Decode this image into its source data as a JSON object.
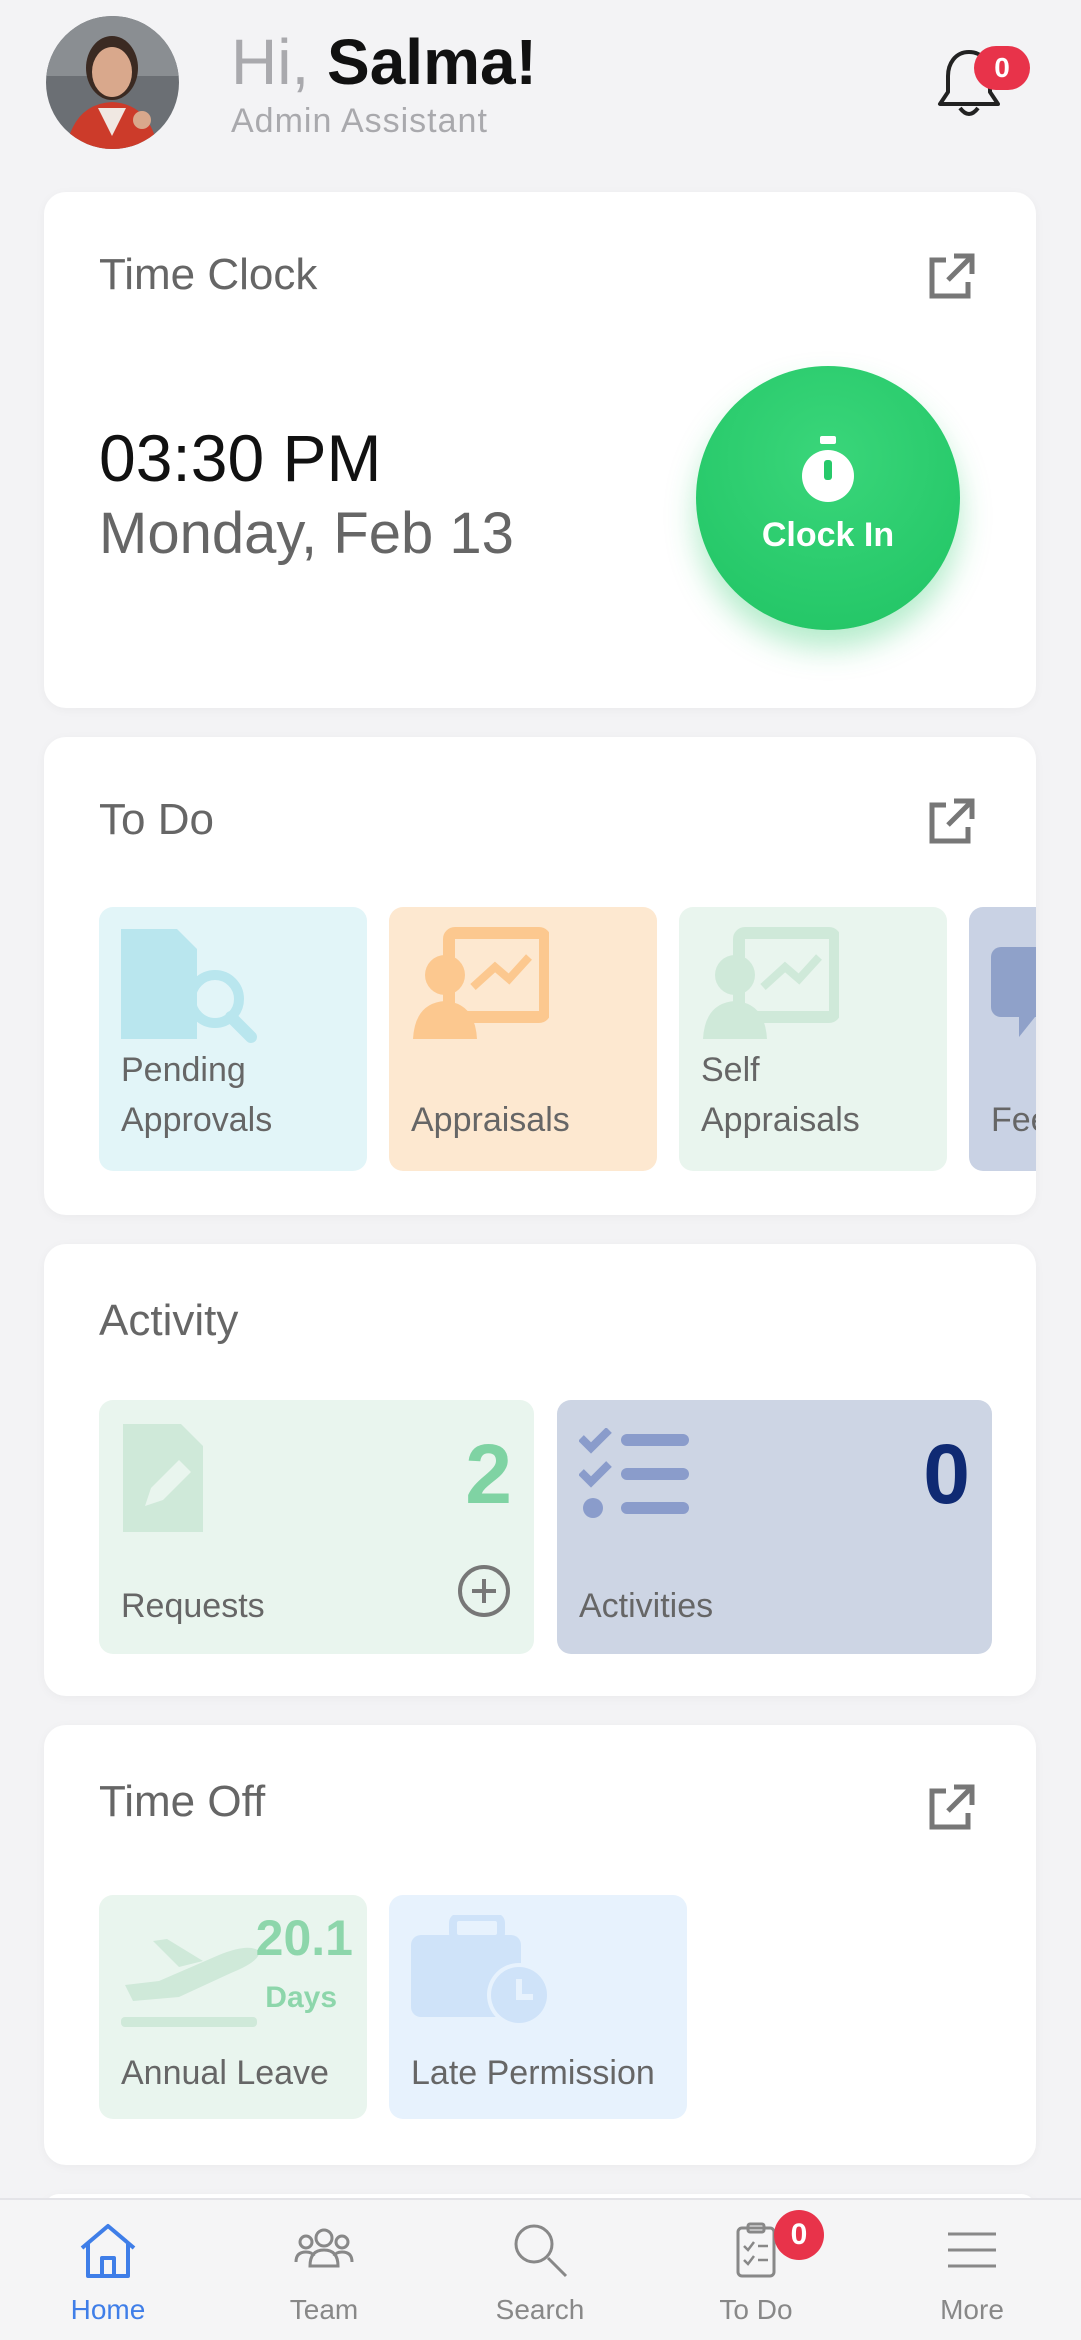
{
  "header": {
    "greeting": "Hi,",
    "name": "Salma!",
    "role": "Admin Assistant",
    "notification_count": "0"
  },
  "time_clock": {
    "title": "Time Clock",
    "time": "03:30 PM",
    "date": "Monday, Feb 13",
    "button_label": "Clock In"
  },
  "todo": {
    "title": "To Do",
    "tiles": [
      {
        "label_line1": "Pending",
        "label_line2": "Approvals",
        "icon": "pending-approvals-icon",
        "bg": "#e2f5f8"
      },
      {
        "label_line1": "",
        "label_line2": "Appraisals",
        "icon": "appraisals-icon",
        "bg": "#fde8d0"
      },
      {
        "label_line1": "Self",
        "label_line2": "Appraisals",
        "icon": "self-appraisals-icon",
        "bg": "#e9f5ee"
      },
      {
        "label_line1": "",
        "label_line2": "Fee",
        "icon": "feedback-icon",
        "bg": "#c9d2e4"
      }
    ]
  },
  "activity": {
    "title": "Activity",
    "requests": {
      "label": "Requests",
      "count": "2",
      "color": "#7fd3a3"
    },
    "activities": {
      "label": "Activities",
      "count": "0",
      "color": "#0f2a73"
    }
  },
  "time_off": {
    "title": "Time Off",
    "annual_leave": {
      "label": "Annual Leave",
      "value": "20.1",
      "unit": "Days"
    },
    "late_permission": {
      "label": "Late Permission"
    }
  },
  "nav": {
    "items": [
      {
        "label": "Home",
        "icon": "home-icon",
        "active": true
      },
      {
        "label": "Team",
        "icon": "team-icon"
      },
      {
        "label": "Search",
        "icon": "search-icon"
      },
      {
        "label": "To Do",
        "icon": "todo-clipboard-icon"
      },
      {
        "label": "More",
        "icon": "menu-icon"
      }
    ],
    "todo_badge": "0"
  },
  "colors": {
    "accent_green": "#27c96a",
    "accent_blue": "#3f7ee8",
    "badge_red": "#e8334a"
  }
}
